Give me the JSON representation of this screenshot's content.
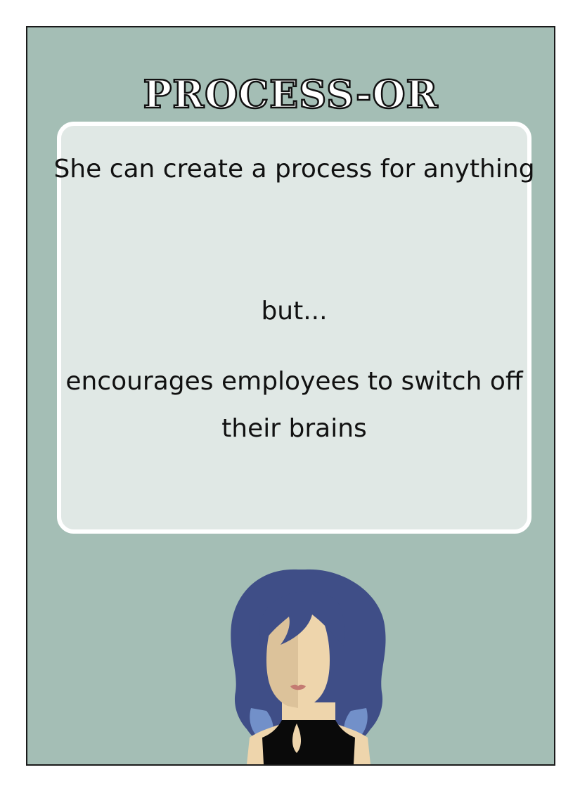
{
  "card": {
    "title": "PROCESS-OR",
    "description": {
      "line1": "She can create a process for anything",
      "line2": "but...",
      "line3": "encourages employees to switch off their brains"
    }
  },
  "colors": {
    "card_background": "#a4beb5",
    "panel_background": "#e0e8e5",
    "hair": "#3f4e87",
    "hair_highlight": "#7290c9",
    "skin_light": "#eed5ac",
    "skin_dark": "#dcc29a",
    "lips": "#c47b72",
    "top": "#0a0a0a"
  },
  "icons": {
    "portrait": "woman-avatar-icon"
  }
}
